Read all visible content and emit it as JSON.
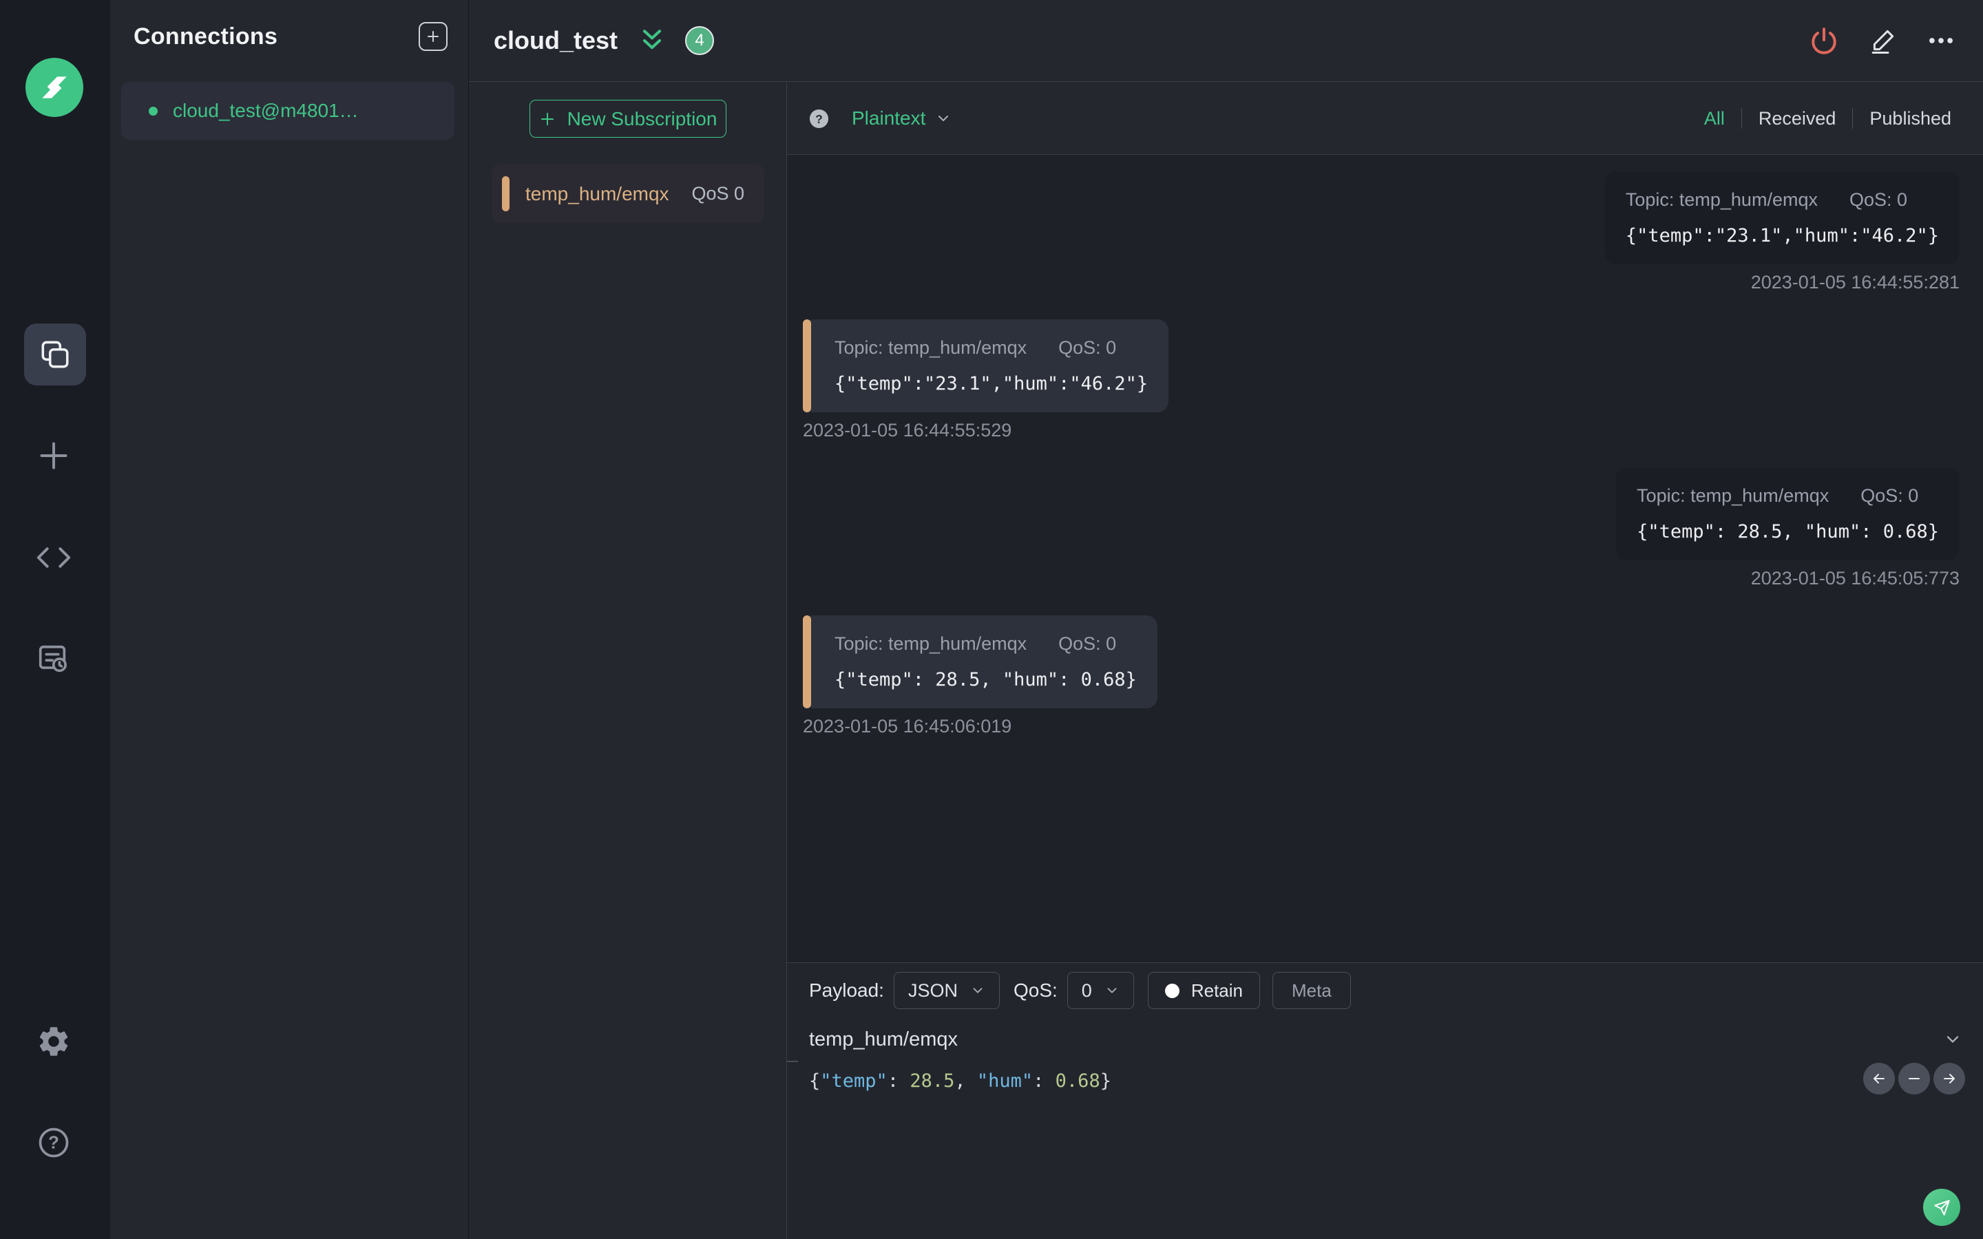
{
  "colors": {
    "accent_green": "#3fc586",
    "disconnect_red": "#e0685c",
    "topic_tan": "#d9a878",
    "badge_green": "#53b183"
  },
  "icons": {
    "mqttx-logo": "green circle with white double-bolt",
    "connections-icon": "overlapping squares",
    "new-connection-icon": "plus",
    "script-icon": "code brackets",
    "log-icon": "document with clock",
    "settings-icon": "gear",
    "help-icon": "question mark circle",
    "disconnect-icon": "power symbol",
    "edit-icon": "pencil",
    "more-icon": "ellipsis",
    "send-icon": "paper plane"
  },
  "connections_panel": {
    "title": "Connections",
    "items": [
      {
        "name": "cloud_test@m4801…",
        "status": "connected"
      }
    ]
  },
  "header": {
    "title": "cloud_test",
    "badge_count": "4"
  },
  "subscriptions": {
    "new_subscription_label": "New Subscription",
    "items": [
      {
        "topic": "temp_hum/emqx",
        "qos": "QoS 0"
      }
    ]
  },
  "messages": {
    "format_selector": "Plaintext",
    "filters": [
      "All",
      "Received",
      "Published"
    ],
    "active_filter": "All",
    "items": [
      {
        "direction": "published",
        "topic_label": "Topic: temp_hum/emqx",
        "qos_label": "QoS: 0",
        "payload": "{\"temp\":\"23.1\",\"hum\":\"46.2\"}",
        "timestamp": "2023-01-05 16:44:55:281"
      },
      {
        "direction": "received",
        "topic_label": "Topic: temp_hum/emqx",
        "qos_label": "QoS: 0",
        "payload": "{\"temp\":\"23.1\",\"hum\":\"46.2\"}",
        "timestamp": "2023-01-05 16:44:55:529"
      },
      {
        "direction": "published",
        "topic_label": "Topic: temp_hum/emqx",
        "qos_label": "QoS: 0",
        "payload": "{\"temp\": 28.5, \"hum\": 0.68}",
        "timestamp": "2023-01-05 16:45:05:773"
      },
      {
        "direction": "received",
        "topic_label": "Topic: temp_hum/emqx",
        "qos_label": "QoS: 0",
        "payload": "{\"temp\": 28.5, \"hum\": 0.68}",
        "timestamp": "2023-01-05 16:45:06:019"
      }
    ]
  },
  "publish": {
    "payload_label": "Payload:",
    "payload_format": "JSON",
    "qos_label": "QoS:",
    "qos_value": "0",
    "retain_label": "Retain",
    "meta_label": "Meta",
    "topic_value": "temp_hum/emqx",
    "payload_tokens": [
      {
        "text": "{",
        "type": "punct"
      },
      {
        "text": "\"temp\"",
        "type": "key"
      },
      {
        "text": ": ",
        "type": "punct"
      },
      {
        "text": "28.5",
        "type": "number"
      },
      {
        "text": ", ",
        "type": "punct"
      },
      {
        "text": "\"hum\"",
        "type": "key"
      },
      {
        "text": ": ",
        "type": "punct"
      },
      {
        "text": "0.68",
        "type": "number"
      },
      {
        "text": "}",
        "type": "punct"
      }
    ]
  }
}
